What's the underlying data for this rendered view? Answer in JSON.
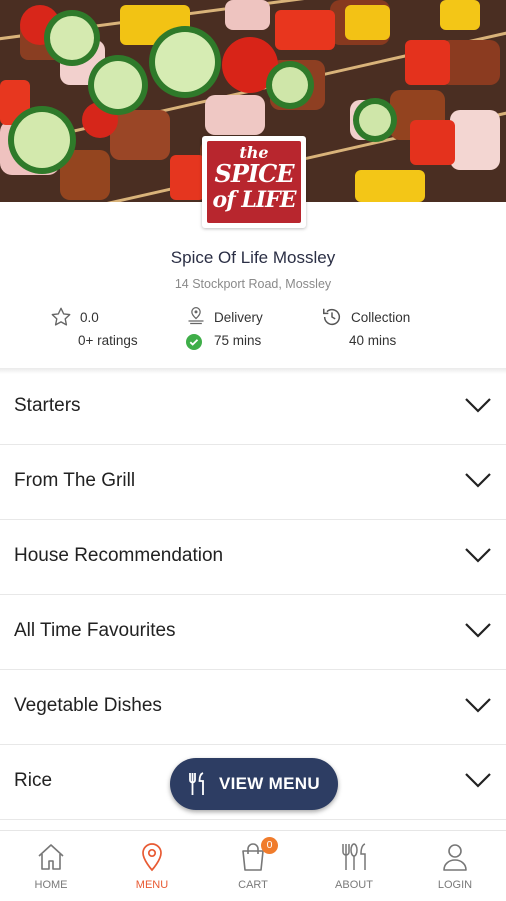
{
  "hero": {
    "logo_line1": "the",
    "logo_line2": "SPICE",
    "logo_line3": "of LIFE"
  },
  "restaurant": {
    "name": "Spice Of Life Mossley",
    "address": "14 Stockport Road, Mossley"
  },
  "stats": {
    "rating_value": "0.0",
    "rating_count": "0+ ratings",
    "delivery_label": "Delivery",
    "delivery_time": "75 mins",
    "collection_label": "Collection",
    "collection_time": "40 mins"
  },
  "categories": [
    {
      "label": "Starters"
    },
    {
      "label": "From The Grill"
    },
    {
      "label": "House Recommendation"
    },
    {
      "label": "All Time Favourites"
    },
    {
      "label": "Vegetable Dishes"
    },
    {
      "label": "Rice"
    }
  ],
  "view_menu": {
    "label": "VIEW MENU",
    "icon": "cutlery-icon"
  },
  "nav": [
    {
      "label": "HOME",
      "icon": "home-icon"
    },
    {
      "label": "MENU",
      "icon": "location-pin-icon",
      "active": true
    },
    {
      "label": "CART",
      "icon": "cart-icon",
      "badge": "0"
    },
    {
      "label": "ABOUT",
      "icon": "cutlery-icon"
    },
    {
      "label": "LOGIN",
      "icon": "user-icon"
    }
  ],
  "colors": {
    "primary_navy": "#2d3d63",
    "accent_orange": "#e85a33",
    "badge_orange": "#f07c2c",
    "logo_red": "#b8262e",
    "check_green": "#3fae49"
  }
}
